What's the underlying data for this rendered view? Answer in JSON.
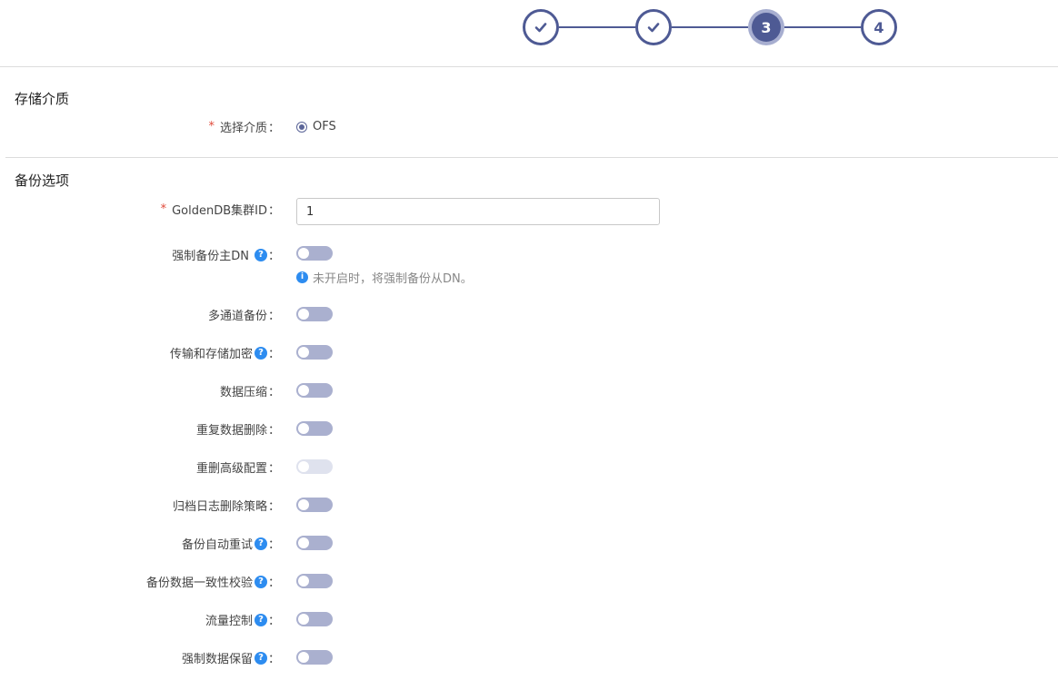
{
  "wizard": {
    "steps": [
      {
        "state": "done"
      },
      {
        "state": "done"
      },
      {
        "state": "active",
        "label": "3"
      },
      {
        "state": "todo",
        "label": "4"
      }
    ]
  },
  "storage": {
    "title": "存储介质",
    "medium_label": "选择介质",
    "medium_value": "OFS"
  },
  "backup": {
    "title": "备份选项",
    "cluster_label": "GoldenDB集群ID",
    "cluster_value": "1",
    "force_primary_label": "强制备份主DN",
    "force_primary_hint": "未开启时，将强制备份从DN。",
    "options": [
      {
        "label": "多通道备份",
        "help": false,
        "enabled": true
      },
      {
        "label": "传输和存储加密",
        "help": true,
        "enabled": true
      },
      {
        "label": "数据压缩",
        "help": false,
        "enabled": true
      },
      {
        "label": "重复数据删除",
        "help": false,
        "enabled": true
      },
      {
        "label": "重删高级配置",
        "help": false,
        "enabled": false
      },
      {
        "label": "归档日志删除策略",
        "help": false,
        "enabled": true
      },
      {
        "label": "备份自动重试",
        "help": true,
        "enabled": true
      },
      {
        "label": "备份数据一致性校验",
        "help": true,
        "enabled": true
      },
      {
        "label": "流量控制",
        "help": true,
        "enabled": true
      },
      {
        "label": "强制数据保留",
        "help": true,
        "enabled": true
      }
    ]
  },
  "colors": {
    "accent": "#4e5a94",
    "toggle_off": "#aab0cf",
    "required": "#e04a3a",
    "help_icon": "#2d8cf0"
  },
  "glyphs": {
    "colon": "：",
    "required_mark": "*",
    "help_mark": "?",
    "info_mark": "i"
  }
}
